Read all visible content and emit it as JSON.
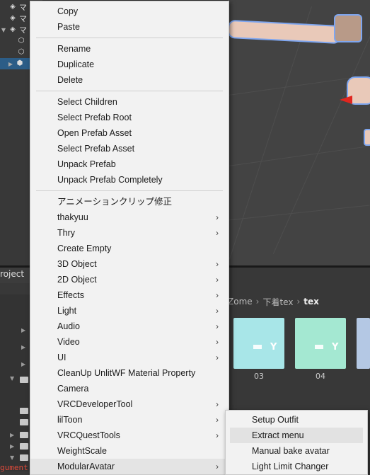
{
  "hierarchy": {
    "rows": [
      {
        "label": "マ",
        "icon": "unity-icon"
      },
      {
        "label": "マ",
        "icon": "unity-icon"
      },
      {
        "label": "マ",
        "icon": "unity-icon"
      },
      {
        "label": "",
        "icon": "cube-icon"
      },
      {
        "label": "",
        "icon": "cube-icon"
      },
      {
        "label": "",
        "icon": "prefab-cube-icon"
      }
    ]
  },
  "project": {
    "tab_label": "roject",
    "error_text": "gument",
    "breadcrumb": [
      "Zome",
      "下着tex",
      "tex"
    ],
    "assets": [
      {
        "label": "03",
        "color": "#a8e6e8"
      },
      {
        "label": "04",
        "color": "#a4e8d2"
      },
      {
        "label": "",
        "color": "#b4c8e4"
      }
    ]
  },
  "context_menu": {
    "groups": [
      [
        {
          "label": "Copy",
          "submenu": false
        },
        {
          "label": "Paste",
          "submenu": false
        }
      ],
      [
        {
          "label": "Rename",
          "submenu": false
        },
        {
          "label": "Duplicate",
          "submenu": false
        },
        {
          "label": "Delete",
          "submenu": false
        }
      ],
      [
        {
          "label": "Select Children",
          "submenu": false
        },
        {
          "label": "Select Prefab Root",
          "submenu": false
        },
        {
          "label": "Open Prefab Asset",
          "submenu": false
        },
        {
          "label": "Select Prefab Asset",
          "submenu": false
        },
        {
          "label": "Unpack Prefab",
          "submenu": false
        },
        {
          "label": "Unpack Prefab Completely",
          "submenu": false
        }
      ],
      [
        {
          "label": "アニメーションクリップ修正",
          "submenu": false
        },
        {
          "label": "thakyuu",
          "submenu": true
        },
        {
          "label": "Thry",
          "submenu": true
        },
        {
          "label": "Create Empty",
          "submenu": false
        },
        {
          "label": "3D Object",
          "submenu": true
        },
        {
          "label": "2D Object",
          "submenu": true
        },
        {
          "label": "Effects",
          "submenu": true
        },
        {
          "label": "Light",
          "submenu": true
        },
        {
          "label": "Audio",
          "submenu": true
        },
        {
          "label": "Video",
          "submenu": true
        },
        {
          "label": "UI",
          "submenu": true
        },
        {
          "label": "CleanUp UnlitWF Material Property",
          "submenu": false
        },
        {
          "label": "Camera",
          "submenu": false
        },
        {
          "label": "VRCDeveloperTool",
          "submenu": true
        },
        {
          "label": "lilToon",
          "submenu": true
        },
        {
          "label": "VRCQuestTools",
          "submenu": true
        },
        {
          "label": "WeightScale",
          "submenu": false
        },
        {
          "label": "ModularAvatar",
          "submenu": true,
          "active": true
        }
      ]
    ],
    "submenu_arrow": "›"
  },
  "modular_avatar_submenu": {
    "items": [
      {
        "label": "Setup Outfit",
        "active": false
      },
      {
        "label": "Extract menu",
        "active": true
      },
      {
        "label": "Manual bake avatar",
        "active": false
      },
      {
        "label": "Light Limit Changer",
        "active": false
      }
    ]
  }
}
